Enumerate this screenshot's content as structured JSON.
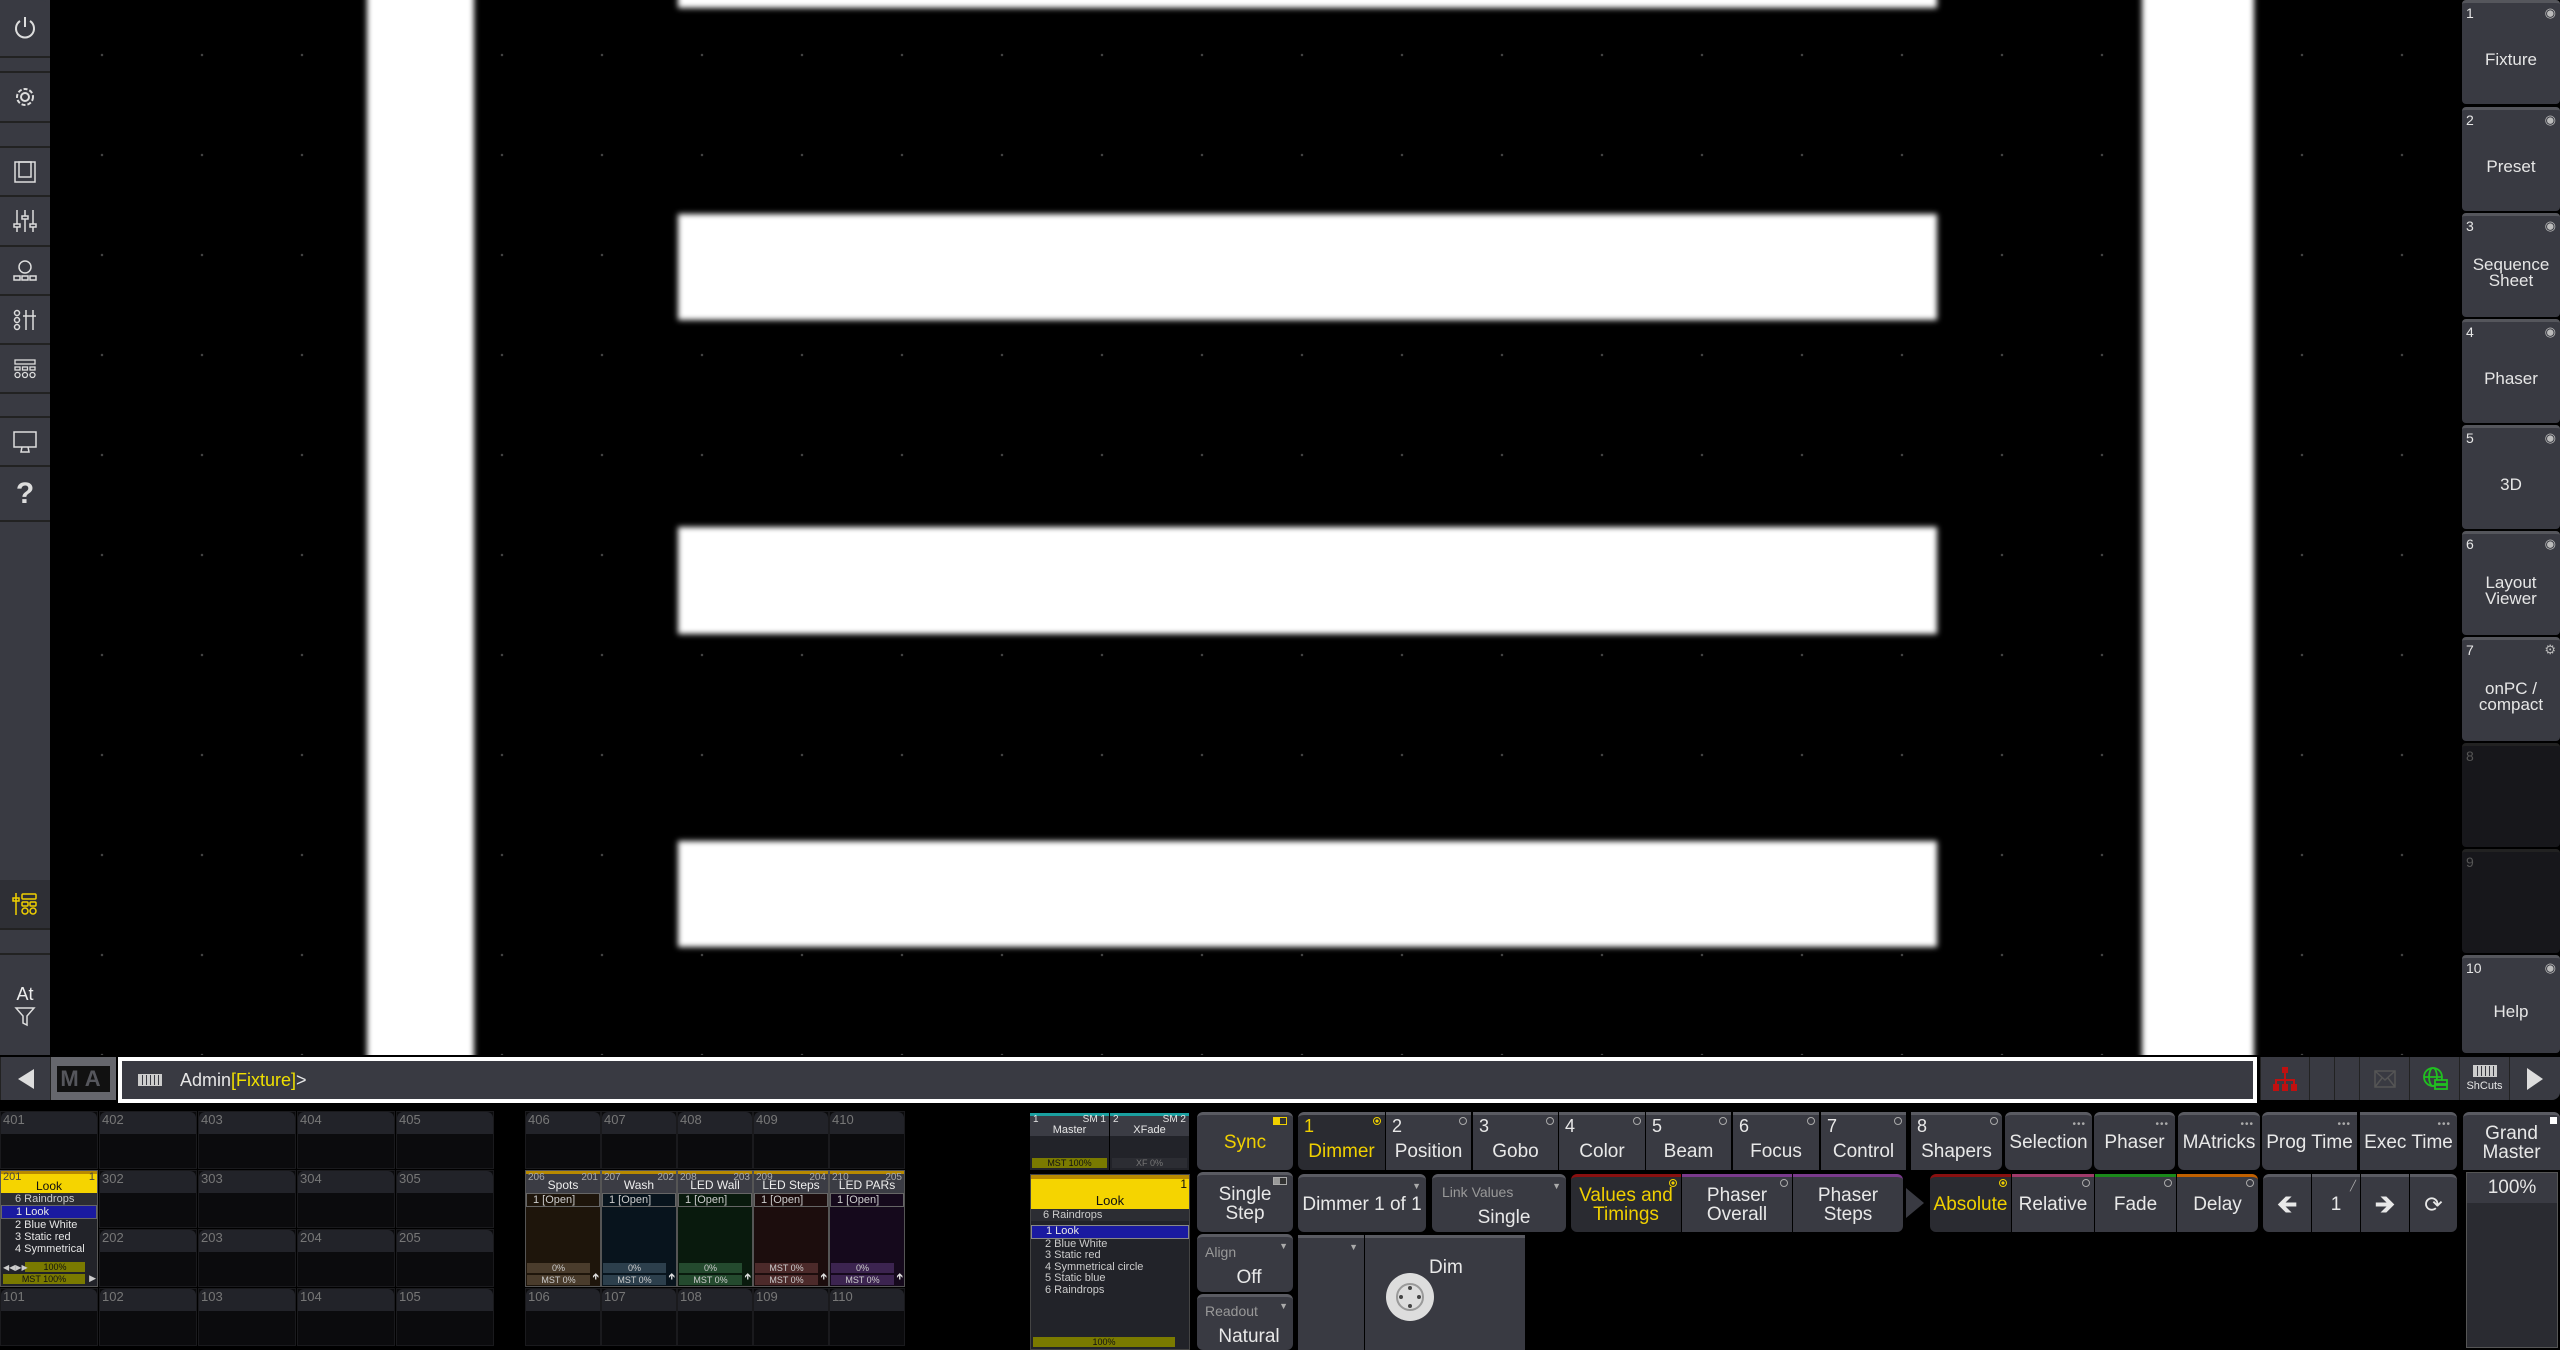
{
  "left_sidebar": {
    "icons": [
      "power-icon",
      "gear-icon",
      "view-icon",
      "faders-icon",
      "fixtures-icon",
      "fader-control-icon",
      "executor-bar-icon",
      "monitor-icon",
      "help-icon",
      "playback-icon",
      "filter-icon"
    ],
    "at_label": "At",
    "active_color": "#f0d000"
  },
  "right_sidebar": {
    "items": [
      {
        "num": "1",
        "label": "Fixture",
        "icon": "eye-icon"
      },
      {
        "num": "2",
        "label": "Preset",
        "icon": "eye-icon"
      },
      {
        "num": "3",
        "label": "Sequence Sheet",
        "icon": "eye-icon"
      },
      {
        "num": "4",
        "label": "Phaser",
        "icon": "eye-icon"
      },
      {
        "num": "5",
        "label": "3D",
        "icon": "eye-icon"
      },
      {
        "num": "6",
        "label": "Layout Viewer",
        "icon": "eye-icon"
      },
      {
        "num": "7",
        "label": "onPC / compact",
        "icon": "screen-settings-icon"
      },
      {
        "num": "8",
        "label": "",
        "icon": ""
      },
      {
        "num": "9",
        "label": "",
        "icon": ""
      },
      {
        "num": "10",
        "label": "Help",
        "icon": "eye-icon"
      }
    ]
  },
  "command_line": {
    "logo": "MA",
    "user": "Admin",
    "destination": "[Fixture]",
    "prompt": ">",
    "shortcuts_label": "ShCuts"
  },
  "executors": {
    "grid_a": {
      "rows": [
        [
          "401",
          "402",
          "403",
          "404",
          "405"
        ],
        [
          "",
          "302",
          "303",
          "304",
          "305"
        ],
        [
          "",
          "202",
          "203",
          "204",
          "205"
        ],
        [
          "101",
          "102",
          "103",
          "104",
          "105"
        ]
      ]
    },
    "grid_b": {
      "rows": [
        [
          "406",
          "407",
          "408",
          "409",
          "410"
        ],
        [
          "106",
          "107",
          "108",
          "109",
          "110"
        ]
      ]
    },
    "look_exec": {
      "num": "201",
      "page": "1",
      "name": "Look",
      "prev": "6 Raindrops",
      "cues": [
        "1 Look",
        "2 Blue White",
        "3 Static red",
        "4 Symmetrical"
      ],
      "rate": "100%",
      "master": "MST 100%"
    },
    "playbacks": [
      {
        "num": "206",
        "seq": "201",
        "name": "Spots",
        "cue": "1 [Open]",
        "value": "0%",
        "master": "MST 0%",
        "bg": "#1e150b",
        "bar": "#4a3c2c"
      },
      {
        "num": "207",
        "seq": "202",
        "name": "Wash",
        "cue": "1 [Open]",
        "value": "0%",
        "master": "MST 0%",
        "bg": "#08141d",
        "bar": "#2c3f4c"
      },
      {
        "num": "208",
        "seq": "203",
        "name": "LED Wall",
        "cue": "1 [Open]",
        "value": "0%",
        "master": "MST 0%",
        "bg": "#091a0d",
        "bar": "#244a2e"
      },
      {
        "num": "209",
        "seq": "204",
        "name": "LED Steps",
        "cue": "1 [Open]",
        "value": "MST 0%",
        "master": "MST 0%",
        "bg": "#1c0d0d",
        "bar": "#4c2a2a"
      },
      {
        "num": "210",
        "seq": "205",
        "name": "LED PARs",
        "cue": "1 [Open]",
        "value": "0%",
        "master": "MST 0%",
        "bg": "#15091c",
        "bar": "#3c2450"
      }
    ]
  },
  "masters": [
    {
      "num": "1",
      "tag": "SM 1",
      "name": "Master",
      "value": "MST 100%"
    },
    {
      "num": "2",
      "tag": "SM 2",
      "name": "XFade",
      "value": "XF 0%"
    }
  ],
  "sequence": {
    "page": "1",
    "name": "Look",
    "prev": "6 Raindrops",
    "cues": [
      "1 Look",
      "2 Blue White",
      "3 Static red",
      "4 Symmetrical circle",
      "5 Static blue",
      "6 Raindrops"
    ],
    "rate": "100%"
  },
  "encoder_bar": {
    "sync": "Sync",
    "single_step": "Single Step",
    "align": {
      "label": "Align",
      "value": "Off"
    },
    "readout": {
      "label": "Readout",
      "value": "Natural"
    },
    "feature_tabs": [
      {
        "num": "1",
        "label": "Dimmer",
        "active": true
      },
      {
        "num": "2",
        "label": "Position"
      },
      {
        "num": "3",
        "label": "Gobo"
      },
      {
        "num": "4",
        "label": "Color"
      },
      {
        "num": "5",
        "label": "Beam"
      },
      {
        "num": "6",
        "label": "Focus"
      },
      {
        "num": "7",
        "label": "Control"
      },
      {
        "num": "8",
        "label": "Shapers"
      }
    ],
    "tools": [
      "Selection",
      "Phaser",
      "MAtricks",
      "Prog Time",
      "Exec Time"
    ],
    "dimmer_count": "Dimmer 1 of 1",
    "link_values": {
      "label": "Link Values",
      "value": "Single"
    },
    "layers": [
      {
        "label": "Values and Timings",
        "color": "#8a1010",
        "active": true
      },
      {
        "label": "Phaser Overall",
        "color": "#7a3a8c"
      },
      {
        "label": "Phaser Steps",
        "color": "#7a3a8c"
      }
    ],
    "modes": [
      {
        "label": "Absolute",
        "color": "#8a1010",
        "active": true
      },
      {
        "label": "Relative",
        "color": "#a03a6a"
      },
      {
        "label": "Fade",
        "color": "#1a8a1a"
      },
      {
        "label": "Delay",
        "color": "#c06000"
      }
    ],
    "step": "1",
    "encoder": {
      "label": "Dim"
    }
  },
  "grand_master": {
    "label": "Grand Master",
    "value": "100%",
    "level": 1.0
  }
}
